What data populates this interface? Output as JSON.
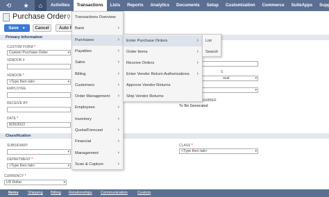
{
  "nav": {
    "items": [
      "Activities",
      "Transactions",
      "Lists",
      "Reports",
      "Analytics",
      "Documents",
      "Setup",
      "Customization",
      "Commerce",
      "SuiteApps",
      "Support"
    ],
    "active_index": 1
  },
  "page": {
    "title": "Purchase Order"
  },
  "buttons": {
    "save": "Save",
    "cancel": "Cancel",
    "auto": "Auto F"
  },
  "sections": {
    "primary": "Primary Information",
    "classification": "Classification"
  },
  "fields": {
    "custom_form": {
      "label": "Custom Form",
      "value": "Custom Purchase Order"
    },
    "vendor_num": {
      "label": "Vendor #"
    },
    "vendor": {
      "label": "Vendor",
      "placeholder": "<Type then tab>"
    },
    "employee": {
      "label": "Employee"
    },
    "receive_by": {
      "label": "Receive By"
    },
    "date": {
      "label": "Date",
      "value": "8/25/2022"
    },
    "subsidiary": {
      "label": "Subsidiary"
    },
    "department": {
      "label": "Department",
      "placeholder": "<Type then tab>"
    },
    "class": {
      "label": "Class",
      "placeholder": "<Type then tab>"
    },
    "currency": {
      "label": "Currency",
      "value": "US Dollar"
    },
    "approval_partial": "oval",
    "status_partial": "s",
    "number_label_partial": "Number",
    "number_value": "To Be Generated"
  },
  "menu1": {
    "items": [
      "Transactions Overview",
      "Bank",
      "Purchases",
      "Payables",
      "Sales",
      "Billing",
      "Customers",
      "Order Management",
      "Employees",
      "Inventory",
      "Quota/Forecast",
      "Financial",
      "Management",
      "Scan & Capture"
    ],
    "chevrons": [
      false,
      true,
      true,
      true,
      true,
      true,
      true,
      true,
      true,
      true,
      true,
      true,
      true,
      true
    ],
    "highlight": 2
  },
  "menu2": {
    "items": [
      "Enter Purchase Orders",
      "Order Items",
      "Receive Orders",
      "Enter Vendor Return Authorizations",
      "Approve Vendor Returns",
      "Ship Vendor Returns"
    ],
    "chevrons": [
      true,
      true,
      true,
      true,
      false,
      false
    ],
    "highlight": 0
  },
  "menu3": {
    "items": [
      "List",
      "Search"
    ]
  },
  "tabs": [
    "Items",
    "Shipping",
    "Billing",
    "Relationships",
    "Communication",
    "Custom"
  ],
  "active_tab": 0,
  "icons": [
    "history-icon",
    "star-icon",
    "home-icon",
    "search-icon",
    "chevron-right-icon",
    "dropdown-arrow-icon",
    "form-icon"
  ]
}
